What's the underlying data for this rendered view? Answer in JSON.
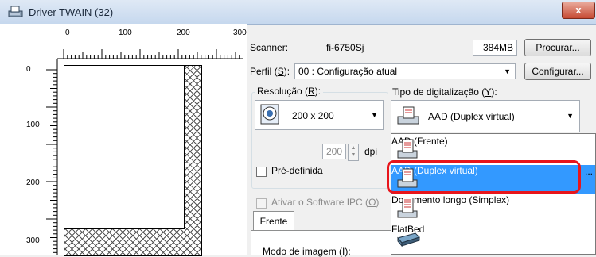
{
  "window": {
    "title": "Driver TWAIN (32)",
    "close_glyph": "x"
  },
  "ruler": {
    "top": [
      "0",
      "100",
      "200",
      "300"
    ],
    "left": [
      "0",
      "100",
      "200",
      "300"
    ]
  },
  "scanner": {
    "label": "Scanner:",
    "model": "fi-6750Sj",
    "memory": "384MB",
    "browse_button": "Procurar..."
  },
  "profile": {
    "label": "Perfil",
    "key": "S",
    "value": "00 : Configuração atual",
    "configure_button": "Configurar..."
  },
  "resolution": {
    "label": "Resolução",
    "key": "R",
    "value": "200 x 200",
    "dpi_value": "200",
    "dpi_unit": "dpi",
    "predefined_label": "Pré-definida"
  },
  "scan_type": {
    "label": "Tipo de digitalização",
    "key": "Y",
    "value": "AAD (Duplex virtual)",
    "options": [
      {
        "label": "AAD (Frente)",
        "icon": "scanner-feeder-icon"
      },
      {
        "label": "AAD (Duplex virtual)",
        "icon": "scanner-duplex-icon",
        "selected": true
      },
      {
        "label": "Documento longo (Simplex)",
        "icon": "long-document-icon"
      },
      {
        "label": "FlatBed",
        "icon": "flatbed-icon"
      }
    ],
    "highlight_color": "#3399ff",
    "annotation_color": "#e8151b"
  },
  "ipc": {
    "label": "Ativar o Software IPC",
    "key": "O"
  },
  "tabs": {
    "front": "Frente"
  },
  "image_mode": {
    "label": "Modo de imagem (I):"
  },
  "side_label": "..."
}
